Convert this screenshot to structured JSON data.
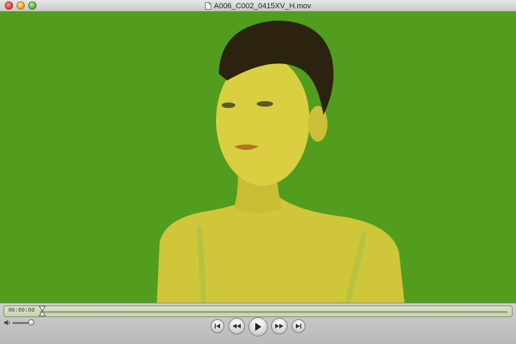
{
  "window": {
    "title": "A006_C002_0415XV_H.mov"
  },
  "player": {
    "timecode": "00:00:00",
    "progress": 0.0,
    "volume": 0.8
  },
  "colors": {
    "video_background": "#4f9b1c",
    "skin": "#d8cf3f",
    "hair": "#2b2210"
  },
  "icons": {
    "close": "close-icon",
    "minimize": "minimize-icon",
    "zoom": "zoom-icon",
    "document": "document-icon",
    "volume": "speaker-icon",
    "skip_start": "skip-to-start-icon",
    "rewind": "rewind-icon",
    "play": "play-icon",
    "fast_forward": "fast-forward-icon",
    "skip_end": "skip-to-end-icon"
  }
}
